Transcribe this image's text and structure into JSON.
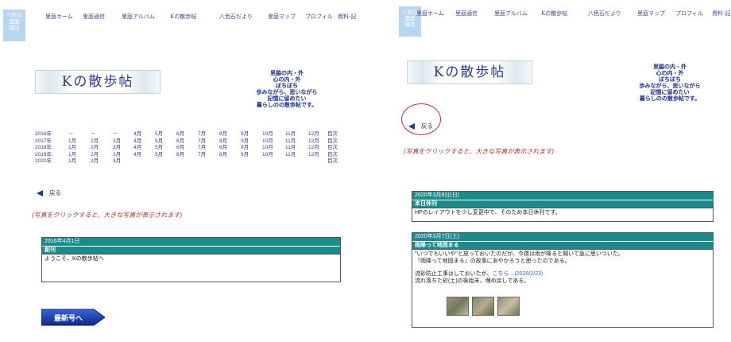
{
  "logo": {
    "lines": [
      "八色石",
      "里庭",
      "雑話"
    ]
  },
  "nav": [
    "里庭ホーム",
    "里庭通信",
    "里庭アルバム",
    "Kの散歩帖",
    "八色石だより",
    "里庭マップ",
    "プロフィル",
    "資料-記"
  ],
  "nav_right": [
    "里庭ホーム",
    "里庭通信",
    "里庭アルバム",
    "Kの散歩帖",
    "八色石だより",
    "里庭マップ",
    "プロフィル",
    "資料-記"
  ],
  "banner_title": "Kの散歩帖",
  "tagline": [
    "里脇の内・外",
    "心の内・外",
    "ぼちぼち",
    "歩みながら、思いながら",
    "記憶に留めたい",
    "暮らしのの散歩帖です。"
  ],
  "archive": {
    "rows": [
      {
        "year": "2016年:",
        "months": [
          "－",
          "－",
          "－",
          "4月",
          "5月",
          "6月",
          "7月",
          "8月",
          "9月",
          "10月",
          "11月",
          "12月"
        ],
        "index": "目次"
      },
      {
        "year": "2017年:",
        "months": [
          "1月",
          "2月",
          "3月",
          "4月",
          "5月",
          "6月",
          "7月",
          "8月",
          "9月",
          "10月",
          "11月",
          "12月"
        ],
        "index": "目次"
      },
      {
        "year": "2018年:",
        "months": [
          "1月",
          "2月",
          "3月",
          "4月",
          "5月",
          "6月",
          "7月",
          "8月",
          "9月",
          "10月",
          "11月",
          "12月"
        ],
        "index": "目次"
      },
      {
        "year": "2019年:",
        "months": [
          "1月",
          "2月",
          "3月",
          "4月",
          "5月",
          "6月",
          "7月",
          "8月",
          "9月",
          "10月",
          "11月",
          "12月"
        ],
        "index": "目次"
      },
      {
        "year": "2020年:",
        "months": [
          "1月",
          "2月",
          "3月",
          "",
          "",
          "",
          "",
          "",
          "",
          "",
          "",
          ""
        ],
        "index": "目次"
      }
    ]
  },
  "back_label": "戻る",
  "hint": "(写真をクリックすると、大きな写真が表示されます)",
  "left_post": {
    "date": "2016年4月1日",
    "title": "創刊",
    "body": "ようこそ、Kの散歩帖へ"
  },
  "newest_button": "最新号へ",
  "right_posts": [
    {
      "date": "2020年3月8日(日)",
      "title": "本日休刊",
      "body": [
        "HPのレイアウトを少し変更中で、そのため本日休刊です。"
      ]
    },
    {
      "date": "2020年3月7日(土)",
      "title": "雨降って地固まる",
      "body": [
        "\"いつでもいいや\"と放っておいたのだが、今夜は雨が降ると聞いて急に思いついた。",
        "『雨降って地固まる』の故事にあやかろうと思ったのである。",
        "",
        "流砂防止工事はしておいたが",
        "流れ落ちた砂(土)の後始末、埋め戻しである。"
      ],
      "link": "こちら→(2020/2/23)"
    }
  ]
}
